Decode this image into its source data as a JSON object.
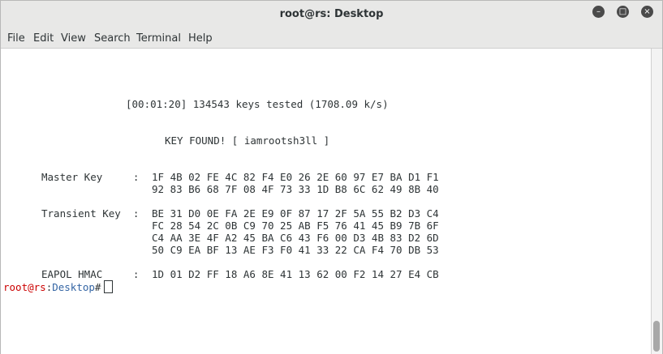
{
  "window": {
    "title": "root@rs: Desktop"
  },
  "menu": [
    "File",
    "Edit",
    "View",
    "Search",
    "Terminal",
    "Help"
  ],
  "terminal": {
    "progress": "[00:01:20] 134543 keys tested (1708.09 k/s)",
    "key_found": "KEY FOUND! [ iamrootsh3ll ]",
    "master_key_label": "Master Key     :",
    "master_key": [
      "1F 4B 02 FE 4C 82 F4 E0 26 2E 60 97 E7 BA D1 F1",
      "92 83 B6 68 7F 08 4F 73 33 1D B8 6C 62 49 8B 40"
    ],
    "transient_key_label": "Transient Key  :",
    "transient_key": [
      "BE 31 D0 0E FA 2E E9 0F 87 17 2F 5A 55 B2 D3 C4",
      "FC 28 54 2C 0B C9 70 25 AB F5 76 41 45 B9 7B 6F",
      "C4 AA 3E 4F A2 45 BA C6 43 F6 00 D3 4B 83 D2 6D",
      "50 C9 EA BF 13 AE F3 F0 41 33 22 CA F4 70 DB 53"
    ],
    "eapol_label": "EAPOL HMAC     :",
    "eapol": "1D 01 D2 FF 18 A6 8E 41 13 62 00 F2 14 27 E4 CB",
    "prompt_user": "root@rs",
    "prompt_sep": ":",
    "prompt_path": "Desktop",
    "prompt_symbol": "#"
  }
}
